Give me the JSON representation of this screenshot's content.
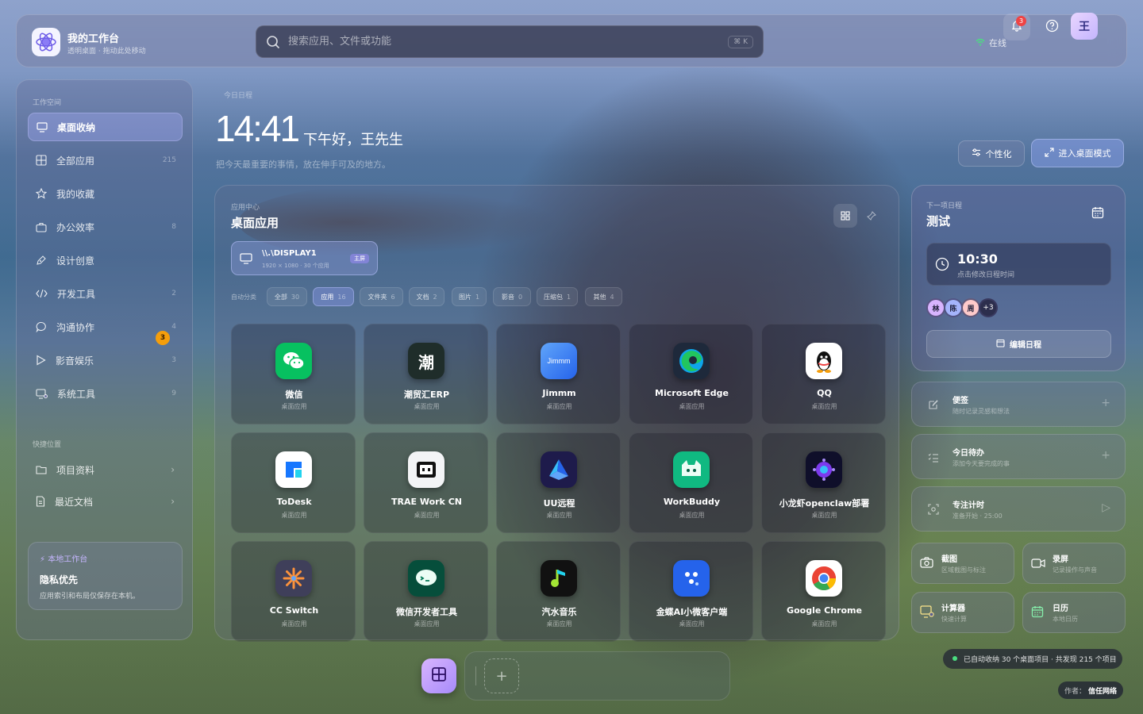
{
  "header": {
    "brand_title": "我的工作台",
    "brand_sub": "透明桌面 · 拖动此处移动",
    "search_placeholder": "搜索应用、文件或功能",
    "shortcut": "⌘ K",
    "status": "在线",
    "notifications": "3",
    "avatar": "王"
  },
  "sidebar": {
    "section_workspace": "工作空间",
    "items": [
      {
        "label": "桌面收纳",
        "icon": "monitor-icon",
        "count": ""
      },
      {
        "label": "全部应用",
        "icon": "grid-icon",
        "count": "215"
      },
      {
        "label": "我的收藏",
        "icon": "star-icon",
        "count": ""
      },
      {
        "label": "办公效率",
        "icon": "briefcase-icon",
        "count": "8"
      },
      {
        "label": "设计创意",
        "icon": "palette-icon",
        "count": ""
      },
      {
        "label": "开发工具",
        "icon": "code-icon",
        "count": "2"
      },
      {
        "label": "沟通协作",
        "icon": "chat-icon",
        "count": "4"
      },
      {
        "label": "影音娱乐",
        "icon": "play-icon",
        "count": "3"
      },
      {
        "label": "系统工具",
        "icon": "settings-monitor-icon",
        "count": "9"
      }
    ],
    "section_quick": "快捷位置",
    "quick": [
      {
        "label": "项目资料",
        "icon": "folder-icon"
      },
      {
        "label": "最近文档",
        "icon": "document-icon"
      }
    ],
    "privacy": {
      "tag": "本地工作台",
      "title": "隐私优先",
      "desc": "应用索引和布局仅保存在本机。"
    }
  },
  "hero": {
    "date": "今日日程",
    "clock": "14:41",
    "greeting": "下午好，王先生",
    "tagline": "把今天最重要的事情，放在伸手可及的地方。",
    "personalize": "个性化",
    "desktop_mode": "进入桌面模式"
  },
  "main": {
    "overline": "应用中心",
    "title": "桌面应用",
    "display": {
      "name": "\\\\.\\DISPLAY1",
      "info": "1920 × 1080 · 30 个应用",
      "tag": "主屏"
    },
    "filter_label": "自动分类",
    "filters": [
      {
        "label": "全部",
        "count": "30"
      },
      {
        "label": "应用",
        "count": "16"
      },
      {
        "label": "文件夹",
        "count": "6"
      },
      {
        "label": "文档",
        "count": "2"
      },
      {
        "label": "图片",
        "count": "1"
      },
      {
        "label": "影音",
        "count": "0"
      },
      {
        "label": "压缩包",
        "count": "1"
      },
      {
        "label": "其他",
        "count": "4"
      }
    ],
    "apps": [
      {
        "name": "微信",
        "sub": "桌面应用",
        "icon": "wechat-icon"
      },
      {
        "name": "潮贸汇ERP",
        "sub": "桌面应用",
        "icon": "erp-icon"
      },
      {
        "name": "Jimmm",
        "sub": "桌面应用",
        "icon": "jimmm-icon"
      },
      {
        "name": "Microsoft Edge",
        "sub": "桌面应用",
        "icon": "edge-icon"
      },
      {
        "name": "QQ",
        "sub": "桌面应用",
        "icon": "qq-icon"
      },
      {
        "name": "ToDesk",
        "sub": "桌面应用",
        "icon": "todesk-icon"
      },
      {
        "name": "TRAE Work CN",
        "sub": "桌面应用",
        "icon": "trae-icon"
      },
      {
        "name": "UU远程",
        "sub": "桌面应用",
        "icon": "uu-icon"
      },
      {
        "name": "WorkBuddy",
        "sub": "桌面应用",
        "icon": "workbuddy-icon"
      },
      {
        "name": "小龙虾openclaw部署",
        "sub": "桌面应用",
        "icon": "openclaw-icon"
      },
      {
        "name": "CC Switch",
        "sub": "桌面应用",
        "icon": "ccswitch-icon"
      },
      {
        "name": "微信开发者工具",
        "sub": "桌面应用",
        "icon": "wechat-dev-icon"
      },
      {
        "name": "汽水音乐",
        "sub": "桌面应用",
        "icon": "music-icon"
      },
      {
        "name": "金蝶AI小微客户端",
        "sub": "桌面应用",
        "icon": "kingdee-icon"
      },
      {
        "name": "Google Chrome",
        "sub": "桌面应用",
        "icon": "chrome-icon"
      }
    ],
    "badge": "3"
  },
  "schedule": {
    "overline": "下一项日程",
    "title": "测试",
    "time": "10:30",
    "time_sub": "点击修改日程时间",
    "people": [
      "林",
      "陈",
      "周"
    ],
    "more": "+3",
    "edit": "编辑日程"
  },
  "widgets": [
    {
      "title": "便签",
      "sub": "随时记录灵感和想法",
      "icon": "note-icon",
      "action": "+"
    },
    {
      "title": "今日待办",
      "sub": "添加今天要完成的事",
      "icon": "todo-icon",
      "action": "+"
    },
    {
      "title": "专注计时",
      "sub": "准备开始 · 25:00",
      "icon": "focus-icon",
      "action": "▷"
    }
  ],
  "tools": [
    {
      "title": "截图",
      "sub": "区域截图与标注",
      "icon": "camera-icon"
    },
    {
      "title": "录屏",
      "sub": "记录操作与声音",
      "icon": "video-icon"
    },
    {
      "title": "计算器",
      "sub": "快速计算",
      "icon": "calculator-icon"
    },
    {
      "title": "日历",
      "sub": "本地日历",
      "icon": "calendar-icon"
    }
  ],
  "status_bar": "已自动收纳 30 个桌面项目 · 共发现 215 个项目",
  "author_label": "作者：",
  "author_name": "信任网络",
  "colors": {
    "accent": "#a78bfa",
    "online": "#4ade80",
    "badge": "#ef4444"
  }
}
